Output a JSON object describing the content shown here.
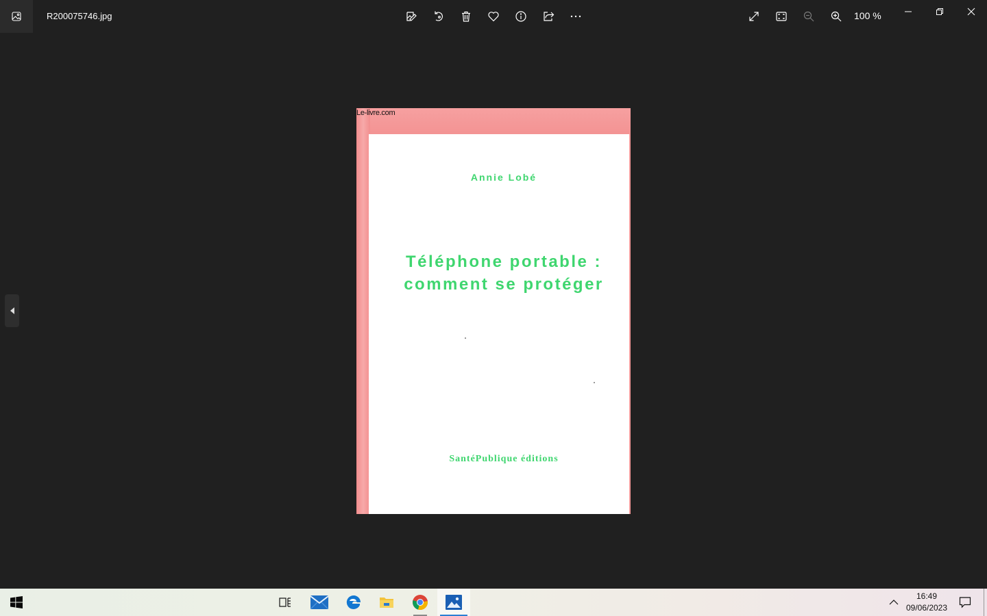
{
  "titlebar": {
    "filename": "R200075746.jpg",
    "zoom_level": "100 %",
    "icons": [
      "gallery-icon",
      "edit-image-icon",
      "rotate-icon",
      "delete-icon",
      "favorite-icon",
      "info-icon",
      "share-icon",
      "more-icon",
      "fullscreen-icon",
      "fit-to-window-icon",
      "zoom-out-icon",
      "zoom-in-icon",
      "minimize-icon",
      "restore-icon",
      "close-icon"
    ]
  },
  "image": {
    "watermark": "Le-livre.com",
    "author": "Annie Lobé",
    "title_line1": "Téléphone portable :",
    "title_line2": "comment se protéger",
    "publisher": "SantéPublique éditions",
    "colors": {
      "cover_pink": "#f49a9a",
      "text_green": "#3fd66f",
      "page_white": "#ffffff"
    }
  },
  "taskbar": {
    "apps": [
      "start-icon",
      "task-view-icon",
      "mail-icon",
      "edge-icon",
      "file-explorer-icon",
      "chrome-icon",
      "photos-icon"
    ],
    "time": "16:49",
    "date": "09/06/2023"
  }
}
